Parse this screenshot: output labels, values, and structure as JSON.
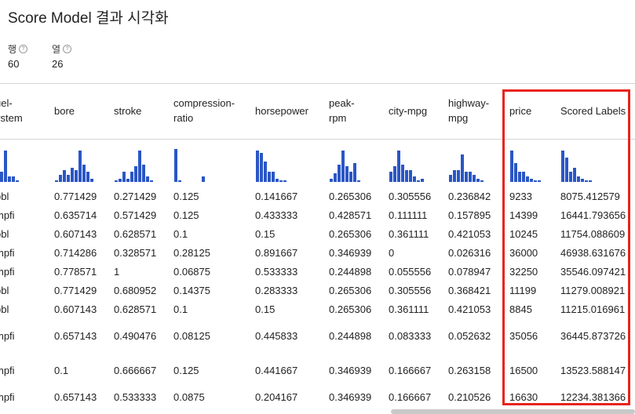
{
  "title": "Score Model 결과 시각화",
  "meta": {
    "rows_label": "행",
    "rows_value": "60",
    "cols_label": "열",
    "cols_value": "26",
    "info_glyph": "?"
  },
  "columns": [
    {
      "key": "fuel-system",
      "label": "uel-\nystem",
      "hist": [
        0.8,
        0.3,
        0.9,
        0.15,
        0.15,
        0.05
      ]
    },
    {
      "key": "bore",
      "label": "bore",
      "hist": [
        0.05,
        0.2,
        0.35,
        0.2,
        0.4,
        0.35,
        0.9,
        0.5,
        0.3,
        0.1
      ]
    },
    {
      "key": "stroke",
      "label": "stroke",
      "hist": [
        0.05,
        0.1,
        0.3,
        0.1,
        0.3,
        0.45,
        0.9,
        0.5,
        0.15,
        0.05
      ]
    },
    {
      "key": "compression-ratio",
      "label": "compression-\nratio",
      "hist": [
        0.95,
        0.05,
        0,
        0,
        0,
        0,
        0,
        0.15
      ]
    },
    {
      "key": "horsepower",
      "label": "horsepower",
      "hist": [
        0.9,
        0.85,
        0.6,
        0.3,
        0.3,
        0.1,
        0.05,
        0.05
      ]
    },
    {
      "key": "peak-rpm",
      "label": "peak-\nrpm",
      "hist": [
        0.1,
        0.25,
        0.5,
        0.9,
        0.45,
        0.3,
        0.55,
        0.05
      ]
    },
    {
      "key": "city-mpg",
      "label": "city-mpg",
      "hist": [
        0.3,
        0.45,
        0.9,
        0.5,
        0.35,
        0.35,
        0.15,
        0.05,
        0.1
      ]
    },
    {
      "key": "highway-mpg",
      "label": "highway-\nmpg",
      "hist": [
        0.2,
        0.35,
        0.35,
        0.8,
        0.3,
        0.3,
        0.2,
        0.1,
        0.05
      ]
    },
    {
      "key": "price",
      "label": "price",
      "hist": [
        0.9,
        0.55,
        0.3,
        0.3,
        0.15,
        0.1,
        0.05,
        0.05
      ]
    },
    {
      "key": "scored-labels",
      "label": "Scored Labels",
      "hist": [
        0.9,
        0.7,
        0.3,
        0.4,
        0.15,
        0.1,
        0.05,
        0.05
      ]
    }
  ],
  "rows": [
    [
      "bbl",
      "0.771429",
      "0.271429",
      "0.125",
      "0.141667",
      "0.265306",
      "0.305556",
      "0.236842",
      "9233",
      "8075.412579"
    ],
    [
      "mpfi",
      "0.635714",
      "0.571429",
      "0.125",
      "0.433333",
      "0.428571",
      "0.111111",
      "0.157895",
      "14399",
      "16441.793656"
    ],
    [
      "bbl",
      "0.607143",
      "0.628571",
      "0.1",
      "0.15",
      "0.265306",
      "0.361111",
      "0.421053",
      "10245",
      "11754.088609"
    ],
    [
      "mpfi",
      "0.714286",
      "0.328571",
      "0.28125",
      "0.891667",
      "0.346939",
      "0",
      "0.026316",
      "36000",
      "46938.631676"
    ],
    [
      "mpfi",
      "0.778571",
      "1",
      "0.06875",
      "0.533333",
      "0.244898",
      "0.055556",
      "0.078947",
      "32250",
      "35546.097421"
    ],
    [
      "bbl",
      "0.771429",
      "0.680952",
      "0.14375",
      "0.283333",
      "0.265306",
      "0.305556",
      "0.368421",
      "11199",
      "11279.008921"
    ],
    [
      "bbl",
      "0.607143",
      "0.628571",
      "0.1",
      "0.15",
      "0.265306",
      "0.361111",
      "0.421053",
      "8845",
      "11215.016961"
    ],
    [
      "mpfi",
      "0.657143",
      "0.490476",
      "0.08125",
      "0.445833",
      "0.244898",
      "0.083333",
      "0.052632",
      "35056",
      "36445.873726"
    ],
    [
      "mpfi",
      "0.1",
      "0.666667",
      "0.125",
      "0.441667",
      "0.346939",
      "0.166667",
      "0.263158",
      "16500",
      "13523.588147"
    ],
    [
      "mpfi",
      "0.657143",
      "0.533333",
      "0.0875",
      "0.204167",
      "0.346939",
      "0.166667",
      "0.210526",
      "16630",
      "12234.381366"
    ]
  ],
  "colors": {
    "bar": "#2a56c6",
    "highlight": "#e8231c"
  }
}
